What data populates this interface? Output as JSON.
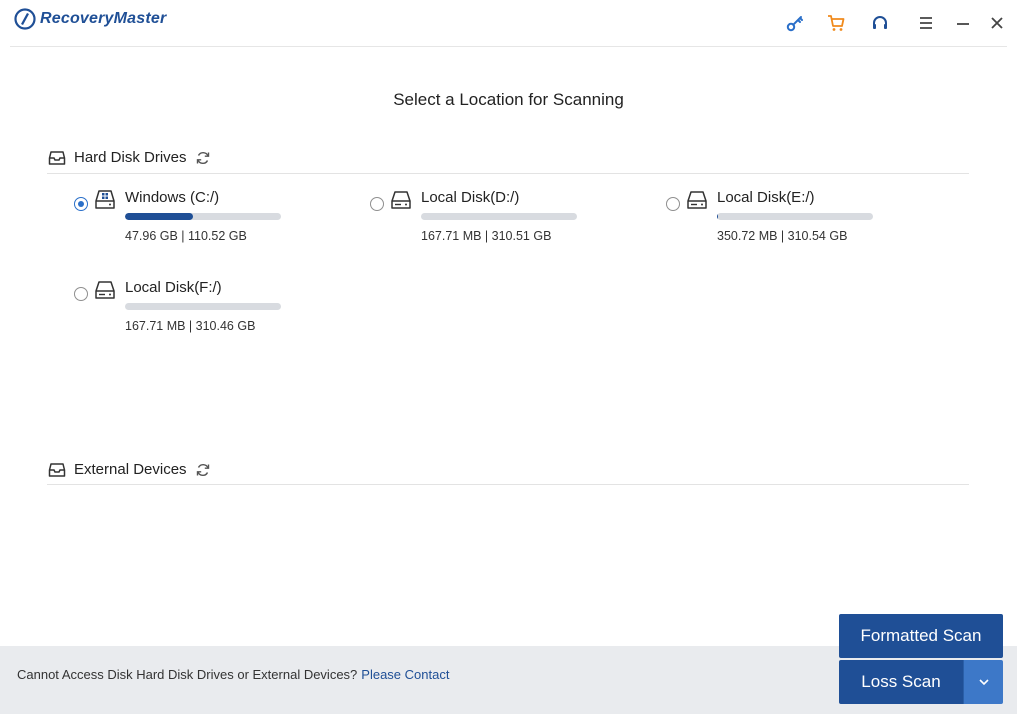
{
  "app": {
    "name": "RecoveryMaster",
    "brand_color": "#1f4f96",
    "accent_color": "#f08a1c"
  },
  "titlebar": {
    "icons": [
      "key-icon",
      "cart-icon",
      "headset-icon",
      "menu-icon",
      "minimize-icon",
      "close-icon"
    ]
  },
  "page_title": "Select a Location for Scanning",
  "hard_disks": {
    "label": "Hard Disk Drives",
    "items": [
      {
        "name": "Windows (C:/)",
        "size": "47.96 GB | 110.52 GB",
        "used_fraction": 0.434,
        "selected": true,
        "icon": "windows-drive-icon"
      },
      {
        "name": "Local Disk(D:/)",
        "size": "167.71 MB | 310.51 GB",
        "used_fraction": 0.0005,
        "selected": false,
        "icon": "hard-drive-icon"
      },
      {
        "name": "Local Disk(E:/)",
        "size": "350.72 MB | 310.54 GB",
        "used_fraction": 0.001,
        "selected": false,
        "icon": "hard-drive-icon"
      },
      {
        "name": "Local Disk(F:/)",
        "size": "167.71 MB | 310.46 GB",
        "used_fraction": 0.0005,
        "selected": false,
        "icon": "hard-drive-icon"
      }
    ]
  },
  "external_devices": {
    "label": "External Devices"
  },
  "footer": {
    "message": "Cannot Access Disk Hard Disk Drives or External Devices?",
    "link": "Please Contact"
  },
  "buttons": {
    "formatted_scan": "Formatted Scan",
    "loss_scan": "Loss Scan"
  }
}
